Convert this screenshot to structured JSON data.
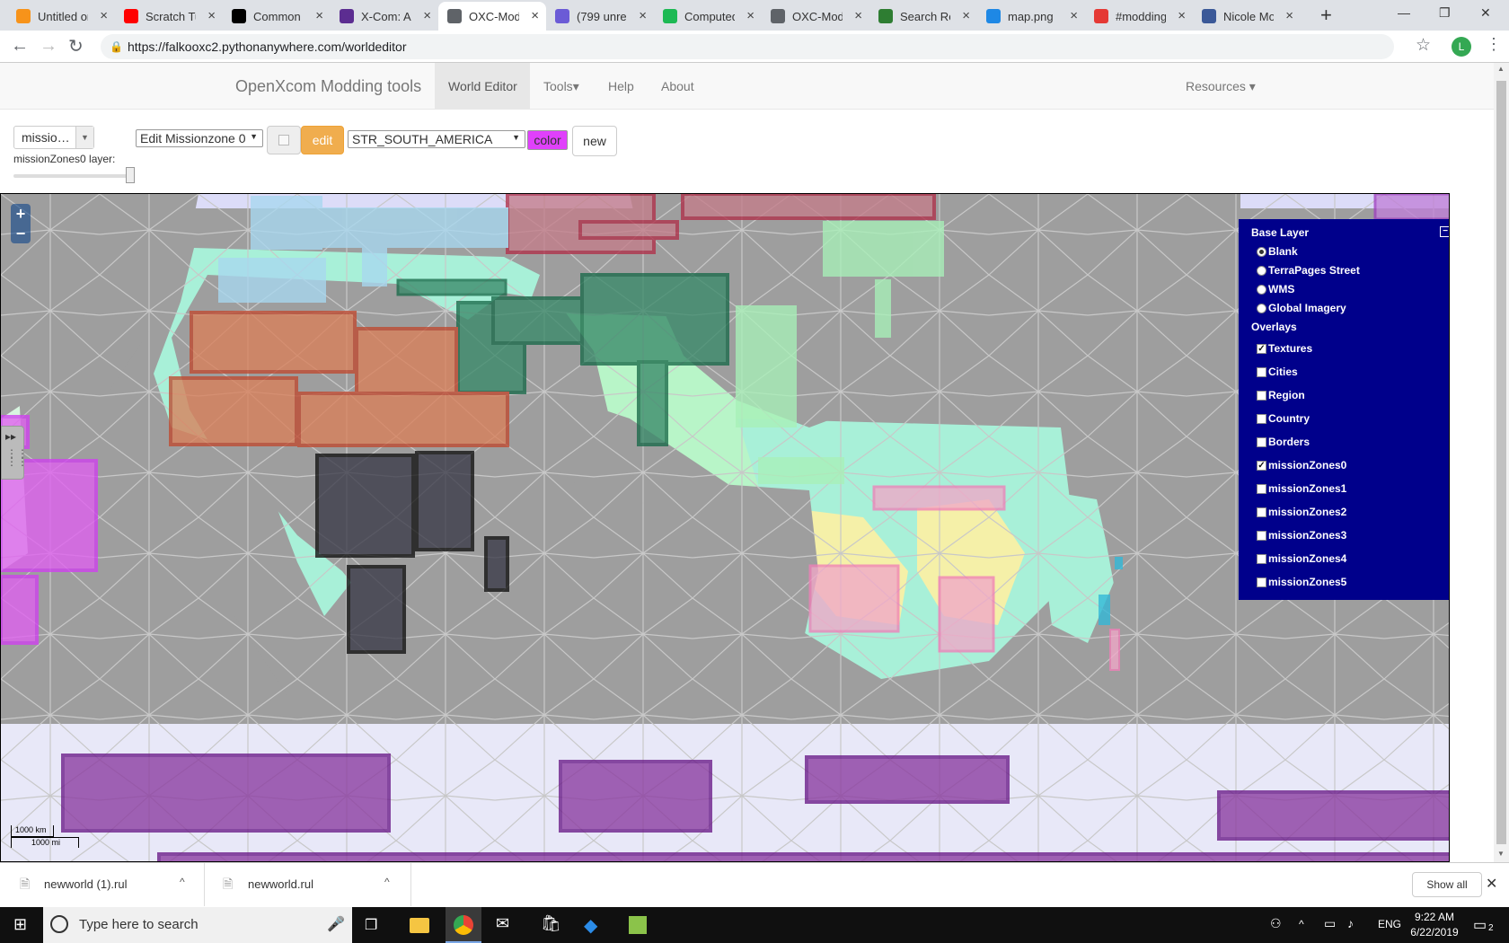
{
  "browser": {
    "tabs": [
      {
        "title": "Untitled or",
        "icon": "bitcoin-icon",
        "color": "#f7931a"
      },
      {
        "title": "Scratch Tu",
        "icon": "youtube-icon",
        "color": "#ff0000"
      },
      {
        "title": "Common y",
        "icon": "wikipedia-icon",
        "color": "#000000"
      },
      {
        "title": "X-Com: Ap",
        "icon": "grid-icon",
        "color": "#5c2d91"
      },
      {
        "title": "OXC-Mod",
        "icon": "globe-icon",
        "color": "#5f6368"
      },
      {
        "title": "(799 unrea",
        "icon": "mail-icon",
        "color": "#6b5bd6"
      },
      {
        "title": "Computed",
        "icon": "d-icon",
        "color": "#1db954"
      },
      {
        "title": "OXC-Mod",
        "icon": "globe-icon",
        "color": "#5f6368"
      },
      {
        "title": "Search Re",
        "icon": "octocat-icon",
        "color": "#2e7d32"
      },
      {
        "title": "map.png",
        "icon": "eye-icon",
        "color": "#1e88e5"
      },
      {
        "title": "#modding",
        "icon": "chat-icon",
        "color": "#e53935"
      },
      {
        "title": "Nicole Mo",
        "icon": "facebook-icon",
        "color": "#3b5998"
      }
    ],
    "active_tab": 4,
    "new_tab": "+",
    "url": "https://falkooxc2.pythonanywhere.com/worldeditor",
    "profile_initial": "L"
  },
  "app": {
    "brand": "OpenXcom Modding tools",
    "nav": [
      "World Editor",
      "Tools",
      "Help",
      "About"
    ],
    "active_nav": "World Editor",
    "tools_caret": "▾",
    "resources": "Resources ▾"
  },
  "toolbar": {
    "layer_select": "missio…",
    "layer_label": "missionZones0 layer:",
    "zone_select": "Edit Missionzone 0",
    "edit_button": "edit",
    "region_select": "STR_SOUTH_AMERICA",
    "color_button": "color",
    "new_button": "new",
    "colors": {
      "edit": "#f0ad4e",
      "color": "#e040fb"
    }
  },
  "map": {
    "zoom_in": "+",
    "zoom_out": "−",
    "scale_km": "1000 km",
    "scale_mi": "1000 mi",
    "layer_switcher": {
      "base_title": "Base Layer",
      "base_layers": [
        {
          "label": "Blank",
          "checked": true
        },
        {
          "label": "TerraPages Street",
          "checked": false
        },
        {
          "label": "WMS",
          "checked": false
        },
        {
          "label": "Global Imagery",
          "checked": false
        }
      ],
      "overlays_title": "Overlays",
      "overlays": [
        {
          "label": "Textures",
          "checked": true
        },
        {
          "label": "Cities",
          "checked": false
        },
        {
          "label": "Region",
          "checked": false
        },
        {
          "label": "Country",
          "checked": false
        },
        {
          "label": "Borders",
          "checked": false
        },
        {
          "label": "missionZones0",
          "checked": true
        },
        {
          "label": "missionZones1",
          "checked": false
        },
        {
          "label": "missionZones2",
          "checked": false
        },
        {
          "label": "missionZones3",
          "checked": false
        },
        {
          "label": "missionZones4",
          "checked": false
        },
        {
          "label": "missionZones5",
          "checked": false
        }
      ],
      "bg_color": "#00008b"
    }
  },
  "downloads": {
    "items": [
      "newworld (1).rul",
      "newworld.rul"
    ],
    "show_all": "Show all"
  },
  "taskbar": {
    "search_placeholder": "Type here to search",
    "lang": "ENG",
    "time": "9:22 AM",
    "date": "6/22/2019",
    "notifications": "2"
  }
}
